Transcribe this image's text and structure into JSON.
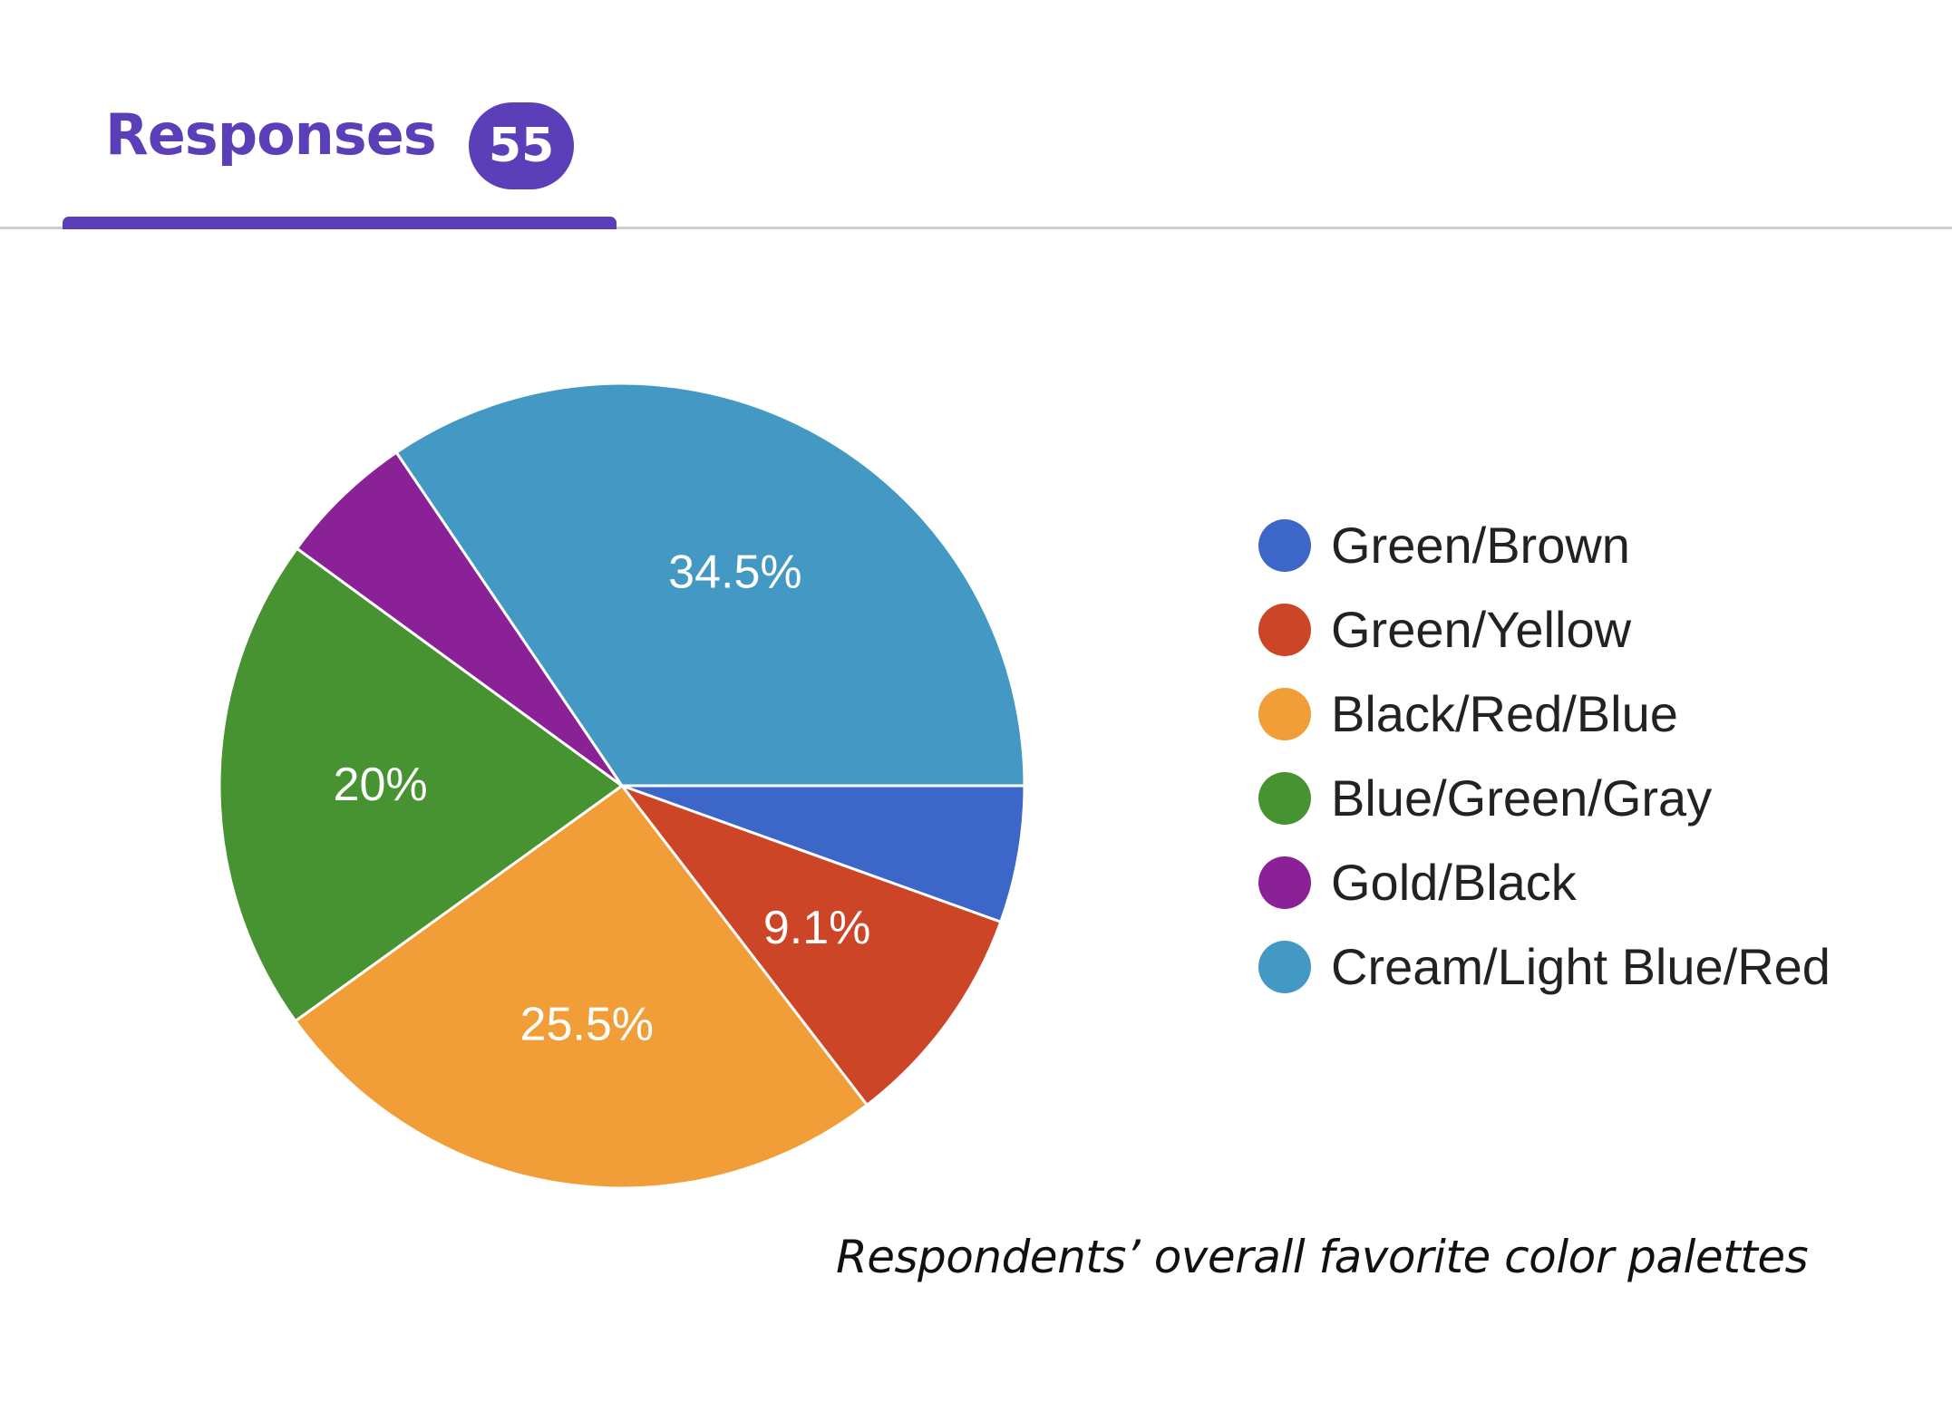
{
  "tabs": {
    "responses_label": "Responses",
    "responses_count": "55",
    "accent_color": "#5b3fb8"
  },
  "chart_data": {
    "type": "pie",
    "title": "",
    "slices": [
      {
        "label": "Green/Brown",
        "value": 5.5,
        "display": "",
        "color": "#3c67c9"
      },
      {
        "label": "Green/Yellow",
        "value": 9.1,
        "display": "9.1%",
        "color": "#cc4527"
      },
      {
        "label": "Black/Red/Blue",
        "value": 25.5,
        "display": "25.5%",
        "color": "#f29e38"
      },
      {
        "label": "Blue/Green/Gray",
        "value": 20,
        "display": "20%",
        "color": "#479231"
      },
      {
        "label": "Gold/Black",
        "value": 5.5,
        "display": "",
        "color": "#8b2196"
      },
      {
        "label": "Cream/Light Blue/Red",
        "value": 34.5,
        "display": "34.5%",
        "color": "#4398c4"
      }
    ],
    "legend_position": "right"
  },
  "caption": "Respondents’ overall favorite color palettes"
}
